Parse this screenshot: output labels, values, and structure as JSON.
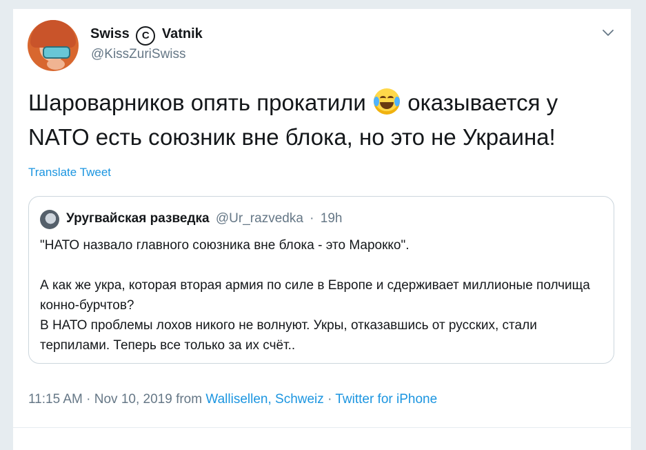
{
  "tweet": {
    "author_name_left": "Swiss",
    "author_name_symbol": "C",
    "author_name_right": "Vatnik",
    "handle": "@KissZuriSwiss",
    "menu_icon": "chevron-down-icon",
    "text_part1": "Шароварников опять прокатили",
    "emoji": "face-with-tears-of-joy",
    "text_part2": "оказывается у NATO есть союзник вне блока, но это не Украина!",
    "translate_label": "Translate Tweet"
  },
  "quoted_tweet": {
    "author_name": "Уругвайская разведка",
    "handle": "@Ur_razvedka",
    "separator": "·",
    "time": "19h",
    "body": "\"НАТО назвало главного союзника вне блока - это Марокко\".\n\nА как же укра, которая вторая армия по силе в Европе и сдерживает миллионые полчища конно-бурчтов?\nВ НАТО проблемы лохов никого не волнуют. Укры, отказавшись от русских, стали терпилами. Теперь все только за их счёт.."
  },
  "meta": {
    "time": "11:15 AM",
    "sep1": "·",
    "date": "Nov 10, 2019",
    "from_label": "from",
    "location": "Wallisellen, Schweiz",
    "sep2": "·",
    "source": "Twitter for iPhone"
  },
  "colors": {
    "link": "#1b95e0",
    "secondary_text": "#657786",
    "border": "#ccd6dd"
  }
}
